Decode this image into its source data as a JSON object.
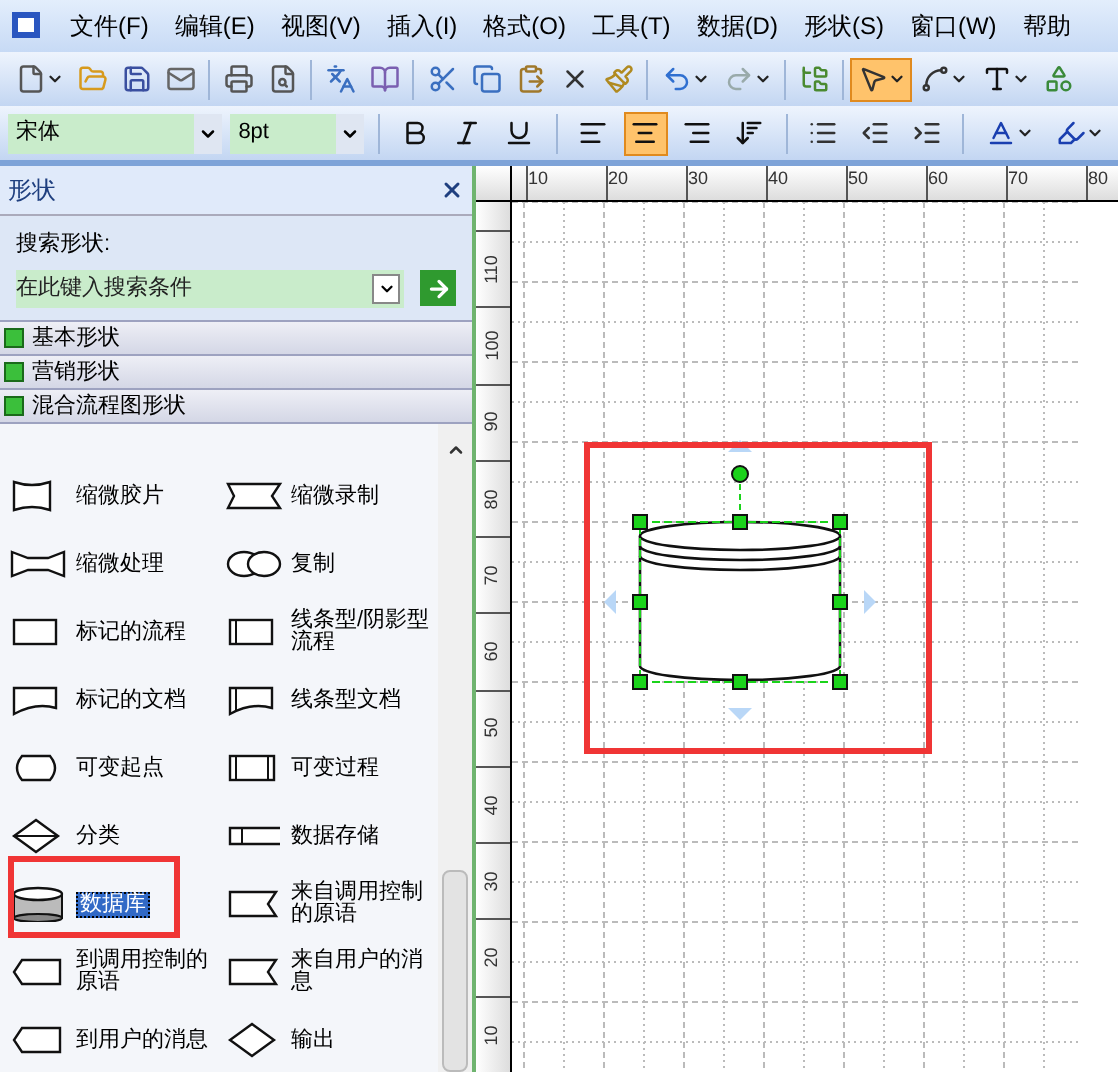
{
  "menu": [
    {
      "label": "文件(F)"
    },
    {
      "label": "编辑(E)"
    },
    {
      "label": "视图(V)"
    },
    {
      "label": "插入(I)"
    },
    {
      "label": "格式(O)"
    },
    {
      "label": "工具(T)"
    },
    {
      "label": "数据(D)"
    },
    {
      "label": "形状(S)"
    },
    {
      "label": "窗口(W)"
    },
    {
      "label": "帮助"
    }
  ],
  "toolbar": [
    {
      "kind": "new",
      "dropdown": true,
      "selected": false
    },
    {
      "kind": "open",
      "dropdown": false,
      "selected": false
    },
    {
      "kind": "save",
      "dropdown": false,
      "selected": false
    },
    {
      "kind": "mail",
      "dropdown": false,
      "selected": false
    },
    {
      "kind": "sep"
    },
    {
      "kind": "print",
      "dropdown": false,
      "selected": false
    },
    {
      "kind": "preview",
      "dropdown": false,
      "selected": false
    },
    {
      "kind": "sep"
    },
    {
      "kind": "spell",
      "dropdown": false,
      "selected": false
    },
    {
      "kind": "research",
      "dropdown": false,
      "selected": false
    },
    {
      "kind": "sep"
    },
    {
      "kind": "cut",
      "dropdown": false,
      "selected": false
    },
    {
      "kind": "copy",
      "dropdown": false,
      "selected": false
    },
    {
      "kind": "paste",
      "dropdown": false,
      "selected": false
    },
    {
      "kind": "delete",
      "dropdown": false,
      "selected": false
    },
    {
      "kind": "format-painter",
      "dropdown": false,
      "selected": false
    },
    {
      "kind": "sep"
    },
    {
      "kind": "undo",
      "dropdown": true,
      "selected": false
    },
    {
      "kind": "redo",
      "dropdown": true,
      "selected": false
    },
    {
      "kind": "sep"
    },
    {
      "kind": "shapes-window",
      "dropdown": false,
      "selected": false
    },
    {
      "kind": "sep"
    },
    {
      "kind": "pointer",
      "dropdown": true,
      "selected": true
    },
    {
      "kind": "connector",
      "dropdown": true,
      "selected": false
    },
    {
      "kind": "text",
      "dropdown": true,
      "selected": false
    },
    {
      "kind": "shape",
      "dropdown": false,
      "selected": false
    }
  ],
  "format_bar": {
    "font": {
      "value": "宋体"
    },
    "size": {
      "value": "8pt"
    },
    "buttons": [
      {
        "kind": "bold",
        "dropdown": false,
        "selected": false
      },
      {
        "kind": "italic",
        "dropdown": false,
        "selected": false
      },
      {
        "kind": "underline",
        "dropdown": false,
        "selected": false
      },
      {
        "kind": "sep"
      },
      {
        "kind": "align-left",
        "dropdown": false,
        "selected": false
      },
      {
        "kind": "align-center",
        "dropdown": false,
        "selected": true
      },
      {
        "kind": "align-right",
        "dropdown": false,
        "selected": false
      },
      {
        "kind": "text-direction",
        "dropdown": false,
        "selected": false
      },
      {
        "kind": "sep"
      },
      {
        "kind": "bullets",
        "dropdown": false,
        "selected": false
      },
      {
        "kind": "indent-decrease",
        "dropdown": false,
        "selected": false
      },
      {
        "kind": "indent-increase",
        "dropdown": false,
        "selected": false
      },
      {
        "kind": "sep"
      },
      {
        "kind": "font-color",
        "dropdown": true,
        "selected": false
      },
      {
        "kind": "line-color",
        "dropdown": true,
        "selected": false
      }
    ]
  },
  "shapes_panel": {
    "title": "形状",
    "search": {
      "label": "搜索形状:",
      "placeholder": "在此键入搜索条件"
    },
    "categories": [
      {
        "label": "基本形状"
      },
      {
        "label": "营销形状"
      },
      {
        "label": "混合流程图形状"
      }
    ],
    "shapes": [
      {
        "label": "缩微胶片",
        "kind": "film",
        "selected": false
      },
      {
        "label": "缩微录制",
        "kind": "tape",
        "selected": false
      },
      {
        "label": "缩微处理",
        "kind": "bowtie",
        "selected": false
      },
      {
        "label": "复制",
        "kind": "double-oval",
        "selected": false
      },
      {
        "label": "标记的流程",
        "kind": "rect",
        "selected": false
      },
      {
        "label": "线条型/阴影型流程",
        "kind": "rect-lined",
        "selected": false
      },
      {
        "label": "标记的文档",
        "kind": "doc",
        "selected": false
      },
      {
        "label": "线条型文档",
        "kind": "doc-lined",
        "selected": false
      },
      {
        "label": "可变起点",
        "kind": "barrel",
        "selected": false
      },
      {
        "label": "可变过程",
        "kind": "barrel-lined",
        "selected": false
      },
      {
        "label": "分类",
        "kind": "diamond-split",
        "selected": false
      },
      {
        "label": "数据存储",
        "kind": "data-store",
        "selected": false
      },
      {
        "label": "数据库",
        "kind": "database",
        "selected": true
      },
      {
        "label": "来自调用控制的原语",
        "kind": "notch",
        "selected": false
      },
      {
        "label": "到调用控制的原语",
        "kind": "tag",
        "selected": false
      },
      {
        "label": "来自用户的消息",
        "kind": "notch",
        "selected": false
      },
      {
        "label": "到用户的消息",
        "kind": "tag",
        "selected": false
      },
      {
        "label": "输出",
        "kind": "diamond",
        "selected": false
      }
    ]
  },
  "rulers": {
    "horizontal": [
      "10",
      "20",
      "30",
      "40",
      "50",
      "60",
      "70",
      "80"
    ],
    "vertical": [
      "110",
      "100",
      "90",
      "80",
      "70",
      "60",
      "50",
      "40",
      "30",
      "20",
      "10"
    ]
  }
}
